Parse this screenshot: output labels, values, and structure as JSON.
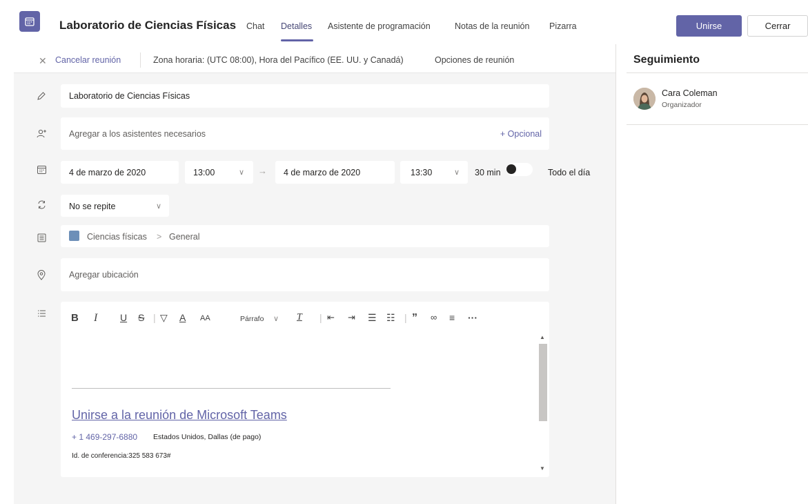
{
  "header": {
    "title": "Laboratorio de Ciencias Físicas",
    "tabs": [
      {
        "label": "Chat"
      },
      {
        "label": "Detalles"
      },
      {
        "label": "Asistente de programación"
      },
      {
        "label": "Notas de la reunión"
      },
      {
        "label": "Pizarra"
      }
    ],
    "active_tab": "Detalles",
    "join_label": "Unirse",
    "close_label": "Cerrar"
  },
  "toolbar": {
    "cancel_label": "Cancelar reunión",
    "timezone": "Zona horaria: (UTC 08:00), Hora del Pacífico (EE. UU. y Canadá)",
    "options_label": "Opciones de reunión"
  },
  "form": {
    "title_value": "Laboratorio de Ciencias Físicas",
    "attendees_placeholder": "Agregar a los asistentes necesarios",
    "optional_label": "+ Opcional",
    "start_date": "4 de marzo de 2020",
    "start_time": "13:00",
    "end_date": "4 de marzo de 2020",
    "end_time": "13:30",
    "duration": "30 min",
    "all_day_label": "Todo el día",
    "all_day_on": false,
    "repeat": "No se repite",
    "channel_team": "Ciencias físicas",
    "channel_separator": ">",
    "channel_name": "General",
    "location_placeholder": "Agregar ubicación"
  },
  "editor": {
    "paragraph_label": "Párrafo",
    "join_link": "Unirse a la reunión de Microsoft Teams",
    "phone": "+ 1 469-297-6880",
    "phone_desc": "Estados Unidos, Dallas (de pago)",
    "conference_id": "Id. de conferencia:325 583 673#"
  },
  "tracking": {
    "title": "Seguimiento",
    "attendees": [
      {
        "name": "Cara Coleman",
        "role": "Organizador"
      }
    ]
  },
  "colors": {
    "accent": "#6264a7",
    "background": "#f5f5f5"
  }
}
